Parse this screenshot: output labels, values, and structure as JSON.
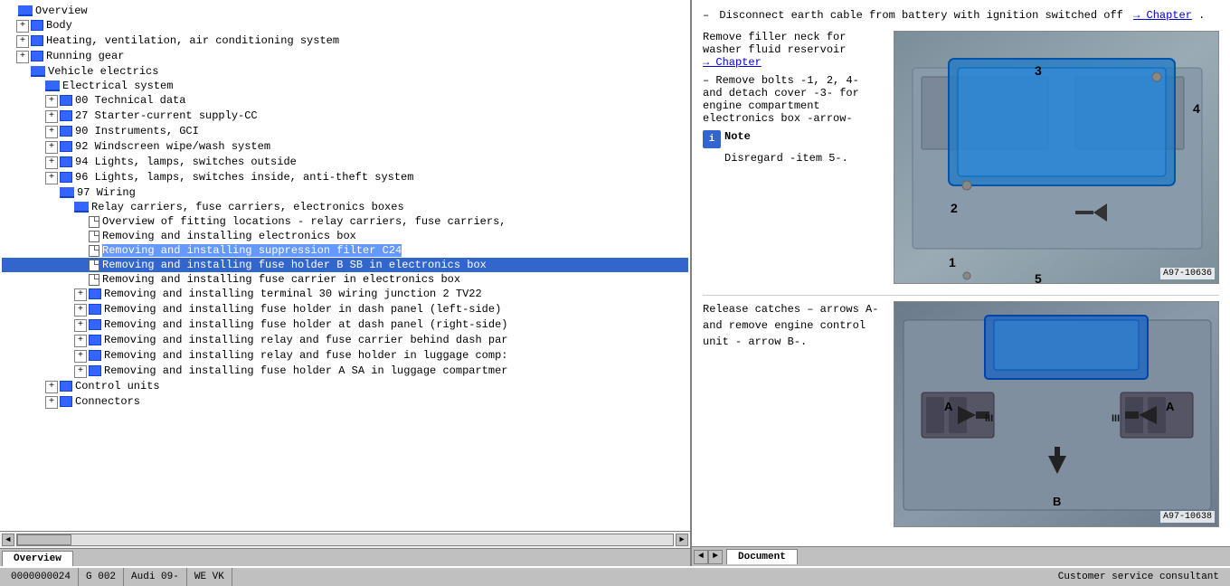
{
  "leftPanel": {
    "treeItems": [
      {
        "id": "overview",
        "level": 0,
        "type": "book-open",
        "text": "Overview",
        "hasExpand": false,
        "expandState": ""
      },
      {
        "id": "body",
        "level": 1,
        "type": "bullet",
        "text": "Body",
        "hasExpand": true,
        "expandState": "+"
      },
      {
        "id": "hvac",
        "level": 1,
        "type": "bullet",
        "text": "Heating, ventilation, air conditioning system",
        "hasExpand": true,
        "expandState": "+"
      },
      {
        "id": "running-gear",
        "level": 1,
        "type": "bullet",
        "text": "Running gear",
        "hasExpand": true,
        "expandState": "+"
      },
      {
        "id": "vehicle-electrics",
        "level": 1,
        "type": "book-open",
        "text": "Vehicle electrics",
        "hasExpand": false,
        "expandState": ""
      },
      {
        "id": "electrical-system",
        "level": 2,
        "type": "book-open",
        "text": "Electrical system",
        "hasExpand": false,
        "expandState": ""
      },
      {
        "id": "00-tech",
        "level": 3,
        "type": "bullet",
        "text": "00 Technical data",
        "hasExpand": true,
        "expandState": "+"
      },
      {
        "id": "27-starter",
        "level": 3,
        "type": "bullet",
        "text": "27 Starter-current supply-CC",
        "hasExpand": true,
        "expandState": "+"
      },
      {
        "id": "90-instruments",
        "level": 3,
        "type": "bullet",
        "text": "90 Instruments, GCI",
        "hasExpand": true,
        "expandState": "+"
      },
      {
        "id": "92-windscreen",
        "level": 3,
        "type": "bullet",
        "text": "92 Windscreen wipe/wash system",
        "hasExpand": true,
        "expandState": "+"
      },
      {
        "id": "94-lights-out",
        "level": 3,
        "type": "bullet",
        "text": "94 Lights, lamps, switches outside",
        "hasExpand": true,
        "expandState": "+"
      },
      {
        "id": "96-lights-in",
        "level": 3,
        "type": "bullet",
        "text": "96 Lights, lamps, switches inside, anti-theft system",
        "hasExpand": true,
        "expandState": "+"
      },
      {
        "id": "97-wiring",
        "level": 3,
        "type": "book-open",
        "text": "97 Wiring",
        "hasExpand": false,
        "expandState": ""
      },
      {
        "id": "relay-carriers",
        "level": 4,
        "type": "book-open",
        "text": "Relay carriers, fuse carriers, electronics boxes",
        "hasExpand": false,
        "expandState": ""
      },
      {
        "id": "overview-fitting",
        "level": 5,
        "type": "doc",
        "text": "Overview of fitting locations - relay carriers, fuse carriers,",
        "hasExpand": false,
        "expandState": ""
      },
      {
        "id": "removing-electronics",
        "level": 5,
        "type": "doc",
        "text": "Removing and installing electronics box",
        "hasExpand": false,
        "expandState": "",
        "selected": false
      },
      {
        "id": "removing-suppression",
        "level": 5,
        "type": "doc",
        "text": "Removing and installing suppression filter C24",
        "hasExpand": false,
        "expandState": "",
        "selected": false,
        "highlighted": true
      },
      {
        "id": "removing-fuse-holder-sb",
        "level": 5,
        "type": "doc",
        "text": "Removing and installing fuse holder B SB in electronics box",
        "hasExpand": false,
        "expandState": "",
        "selected": true
      },
      {
        "id": "removing-fuse-carrier",
        "level": 5,
        "type": "doc",
        "text": "Removing and installing fuse carrier in electronics box",
        "hasExpand": false,
        "expandState": ""
      },
      {
        "id": "removing-terminal-30",
        "level": 5,
        "type": "bullet",
        "text": "Removing and installing terminal 30 wiring junction 2 TV22",
        "hasExpand": true,
        "expandState": "+"
      },
      {
        "id": "removing-fuse-dash-left",
        "level": 5,
        "type": "bullet",
        "text": "Removing and installing fuse holder in dash panel (left-side)",
        "hasExpand": true,
        "expandState": "+"
      },
      {
        "id": "removing-fuse-dash-right",
        "level": 5,
        "type": "bullet",
        "text": "Removing and installing fuse holder at dash panel (right-side)",
        "hasExpand": true,
        "expandState": "+"
      },
      {
        "id": "removing-relay-dash",
        "level": 5,
        "type": "bullet",
        "text": "Removing and installing relay and fuse carrier behind dash par",
        "hasExpand": true,
        "expandState": "+"
      },
      {
        "id": "removing-relay-luggage1",
        "level": 5,
        "type": "bullet",
        "text": "Removing and installing relay and fuse holder in luggage comp:",
        "hasExpand": true,
        "expandState": "+"
      },
      {
        "id": "removing-fuse-holder-sa",
        "level": 5,
        "type": "bullet",
        "text": "Removing and installing fuse holder A SA in luggage compartmer",
        "hasExpand": true,
        "expandState": "+"
      },
      {
        "id": "control-units",
        "level": 3,
        "type": "bullet",
        "text": "Control units",
        "hasExpand": true,
        "expandState": "+"
      },
      {
        "id": "connectors",
        "level": 3,
        "type": "bullet",
        "text": "Connectors",
        "hasExpand": true,
        "expandState": "+"
      }
    ],
    "tabs": [
      {
        "id": "overview-tab",
        "label": "Overview",
        "active": true
      }
    ]
  },
  "rightPanel": {
    "tabs": [
      {
        "id": "document-tab",
        "label": "Document",
        "active": true
      }
    ],
    "content": {
      "instruction1": "Disconnect earth cable from battery with ignition switched off",
      "chapter_link1": "→ Chapter",
      "instruction2": "Remove filler neck for washer fluid reservoir",
      "chapter_link2": "→ Chapter",
      "instruction3": "Remove bolts -1, 2, 4- and detach cover -3- for engine compartment electronics box -arrow-",
      "note_label": "Note",
      "note_text": "Disregard -item 5-.",
      "image1_ref": "A97-10636",
      "image1_labels": [
        "1",
        "2",
        "3",
        "4",
        "5"
      ],
      "instruction4": "Release catches – arrows A- and remove engine control unit - arrow B-.",
      "image2_ref": "A97-10638",
      "arrows_label_A": "A",
      "arrows_label_B": "B"
    }
  },
  "statusBar": {
    "segment1": "0000000024",
    "segment2": "G 002",
    "segment3": "Audi 09-",
    "segment4": "WE VK",
    "segment5": "Customer service consultant"
  }
}
